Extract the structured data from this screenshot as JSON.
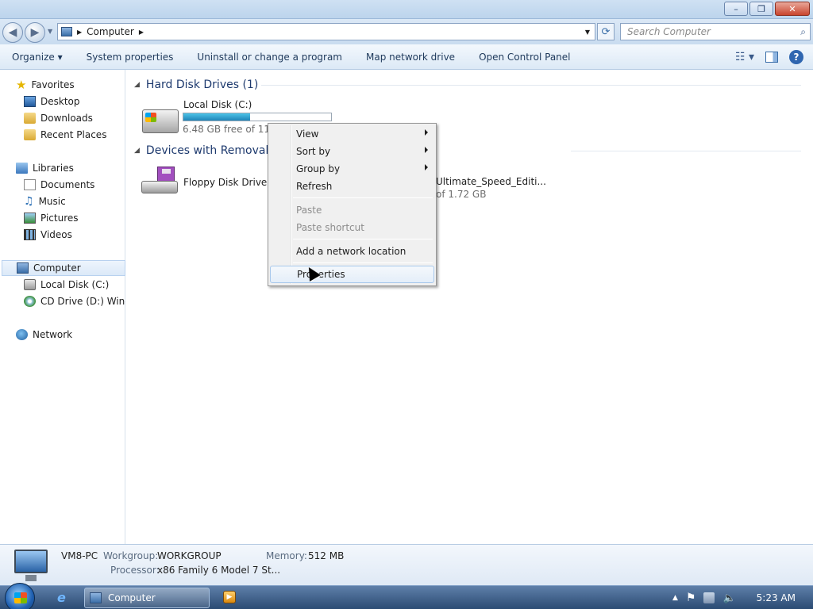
{
  "window": {
    "controls": {
      "minimize": "–",
      "maximize": "❐",
      "close": "✕"
    }
  },
  "address": {
    "path": "Computer",
    "search_placeholder": "Search Computer"
  },
  "toolbar": {
    "organize": "Organize ▾",
    "system_properties": "System properties",
    "uninstall": "Uninstall or change a program",
    "map_drive": "Map network drive",
    "control_panel": "Open Control Panel",
    "help": "?"
  },
  "sidebar": {
    "favorites": "Favorites",
    "desktop": "Desktop",
    "downloads": "Downloads",
    "recent": "Recent Places",
    "libraries": "Libraries",
    "documents": "Documents",
    "music": "Music",
    "pictures": "Pictures",
    "videos": "Videos",
    "computer": "Computer",
    "local_disk": "Local Disk (C:)",
    "cd_drive": "CD Drive (D:) Windo",
    "network": "Network"
  },
  "content": {
    "group_hdd": "Hard Disk Drives (1)",
    "group_removable": "Devices with Removable",
    "local_disk_name": "Local Disk (C:)",
    "local_disk_free": "6.48 GB free of 11.8 G",
    "local_disk_usage_fraction": 0.45,
    "floppy_name": "Floppy Disk Drive (A",
    "cd_name_partial": "Ultimate_Speed_Editi...",
    "cd_name_paren": ")",
    "cd_free_partial": "of 1.72 GB"
  },
  "context_menu": {
    "view": "View",
    "sort_by": "Sort by",
    "group_by": "Group by",
    "refresh": "Refresh",
    "paste": "Paste",
    "paste_shortcut": "Paste shortcut",
    "add_network_location": "Add a network location",
    "properties": "Properties"
  },
  "details": {
    "pc_name": "VM8-PC",
    "workgroup_label": "Workgroup:",
    "workgroup_value": "WORKGROUP",
    "memory_label": "Memory:",
    "memory_value": "512 MB",
    "processor_label": "Processor:",
    "processor_value": "x86 Family 6 Model 7 St..."
  },
  "taskbar": {
    "active_window": "Computer",
    "time": "5:23 AM"
  },
  "colors": {
    "accent": "#2f66b0",
    "usage_bar": "#2084b8",
    "group_heading": "#1e3a6e"
  }
}
